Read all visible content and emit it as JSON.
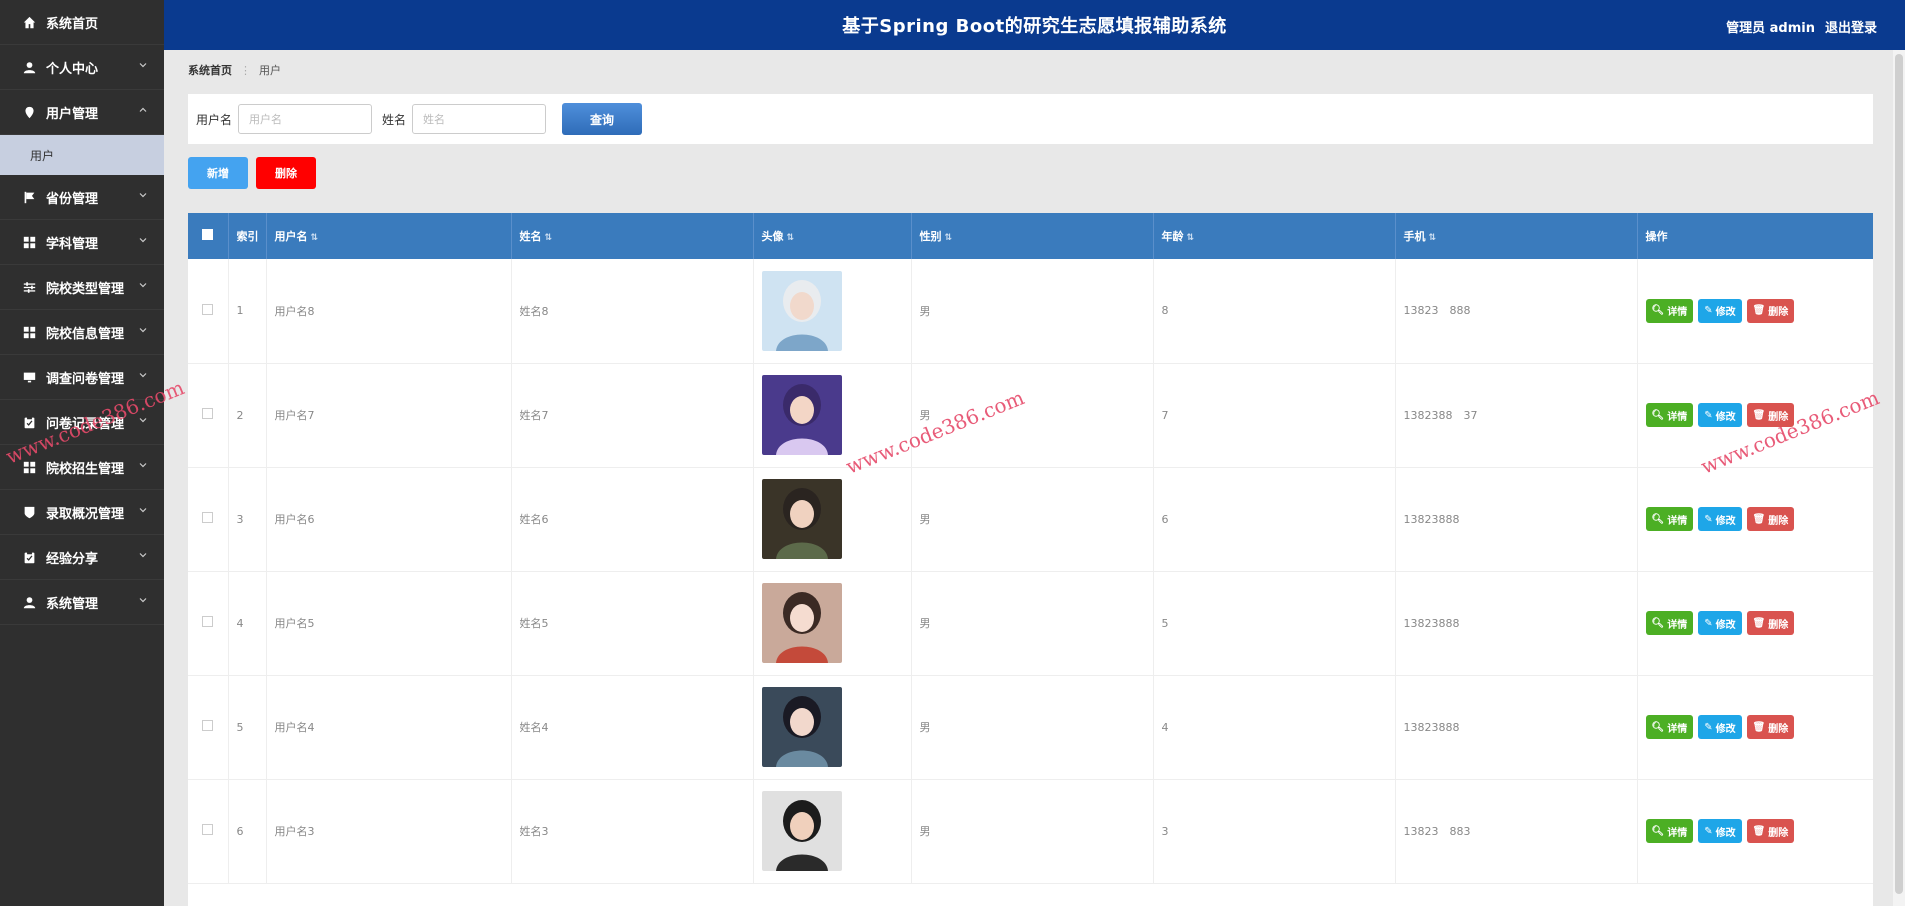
{
  "header": {
    "title": "基于Spring Boot的研究生志愿填报辅助系统",
    "user": "管理员 admin",
    "logout": "退出登录"
  },
  "sidebar": {
    "items": [
      {
        "label": "系统首页",
        "icon": "home-icon"
      },
      {
        "label": "个人中心",
        "icon": "person-icon"
      },
      {
        "label": "用户管理",
        "icon": "pin-icon",
        "expanded": true,
        "sub": "用户"
      },
      {
        "label": "省份管理",
        "icon": "flag-icon"
      },
      {
        "label": "学科管理",
        "icon": "grid-icon"
      },
      {
        "label": "院校类型管理",
        "icon": "sliders-icon"
      },
      {
        "label": "院校信息管理",
        "icon": "grid-icon"
      },
      {
        "label": "调查问卷管理",
        "icon": "monitor-icon"
      },
      {
        "label": "问卷记录管理",
        "icon": "clipboard-icon"
      },
      {
        "label": "院校招生管理",
        "icon": "grid-icon"
      },
      {
        "label": "录取概况管理",
        "icon": "shield-icon"
      },
      {
        "label": "经验分享",
        "icon": "clipboard-icon"
      },
      {
        "label": "系统管理",
        "icon": "person-icon"
      }
    ]
  },
  "breadcrumb": {
    "home": "系统首页",
    "current": "用户"
  },
  "search": {
    "username_label": "用户名",
    "username_placeholder": "用户名",
    "name_label": "姓名",
    "name_placeholder": "姓名",
    "query_label": "查询"
  },
  "actions": {
    "add_label": "新增",
    "delete_label": "删除"
  },
  "table": {
    "columns": [
      "索引",
      "用户名",
      "姓名",
      "头像",
      "性别",
      "年龄",
      "手机",
      "操作"
    ],
    "rows": [
      {
        "index": "1",
        "username": "用户名8",
        "name": "姓名8",
        "gender": "男",
        "age": "8",
        "phone": "13823  888"
      },
      {
        "index": "2",
        "username": "用户名7",
        "name": "姓名7",
        "gender": "男",
        "age": "7",
        "phone": "1382388  37"
      },
      {
        "index": "3",
        "username": "用户名6",
        "name": "姓名6",
        "gender": "男",
        "age": "6",
        "phone": "13823888"
      },
      {
        "index": "4",
        "username": "用户名5",
        "name": "姓名5",
        "gender": "男",
        "age": "5",
        "phone": "13823888"
      },
      {
        "index": "5",
        "username": "用户名4",
        "name": "姓名4",
        "gender": "男",
        "age": "4",
        "phone": "13823888"
      },
      {
        "index": "6",
        "username": "用户名3",
        "name": "姓名3",
        "gender": "男",
        "age": "3",
        "phone": "13823  883"
      }
    ],
    "op_detail": "详情",
    "op_edit": "修改",
    "op_delete": "删除"
  },
  "watermark": "www.code386.com",
  "colors": {
    "header": "#0a3a8f",
    "sidebar": "#2f2f2f",
    "table_head": "#3a7bbd",
    "detail": "#4caf24",
    "edit": "#1ea6e8",
    "delete": "#d9534f"
  }
}
